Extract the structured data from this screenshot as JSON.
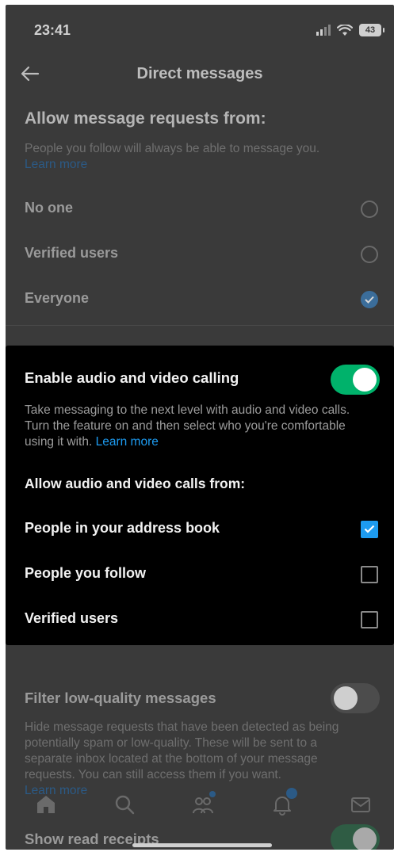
{
  "status_bar": {
    "time": "23:41",
    "battery": "43"
  },
  "header": {
    "title": "Direct messages"
  },
  "message_requests": {
    "heading": "Allow message requests from:",
    "description": "People you follow will always be able to message you.",
    "learn_more": "Learn more",
    "options": [
      {
        "label": "No one",
        "selected": false
      },
      {
        "label": "Verified users",
        "selected": false
      },
      {
        "label": "Everyone",
        "selected": true
      }
    ]
  },
  "calling": {
    "title": "Enable audio and video calling",
    "enabled": true,
    "description": "Take messaging to the next level with audio and video calls. Turn the feature on and then select who you're comfortable using it with.",
    "learn_more": "Learn more",
    "allow_heading": "Allow audio and video calls from:",
    "options": [
      {
        "label": "People in your address book",
        "checked": true
      },
      {
        "label": "People you follow",
        "checked": false
      },
      {
        "label": "Verified users",
        "checked": false
      }
    ]
  },
  "filter": {
    "title": "Filter low-quality messages",
    "enabled": false,
    "description": "Hide message requests that have been detected as being potentially spam or low-quality. These will be sent to a separate inbox located at the bottom of your message requests. You can still access them if you want.",
    "learn_more": "Learn more"
  },
  "read_receipts": {
    "title": "Show read receipts",
    "enabled": true
  },
  "tab_bar": {
    "icons": [
      "home-icon",
      "search-icon",
      "communities-icon",
      "notifications-icon",
      "messages-icon"
    ]
  },
  "colors": {
    "accent": "#1d9bf0",
    "toggle_on": "#00b26b",
    "card_bg": "#000000",
    "dim_bg": "#3a3a3a"
  }
}
